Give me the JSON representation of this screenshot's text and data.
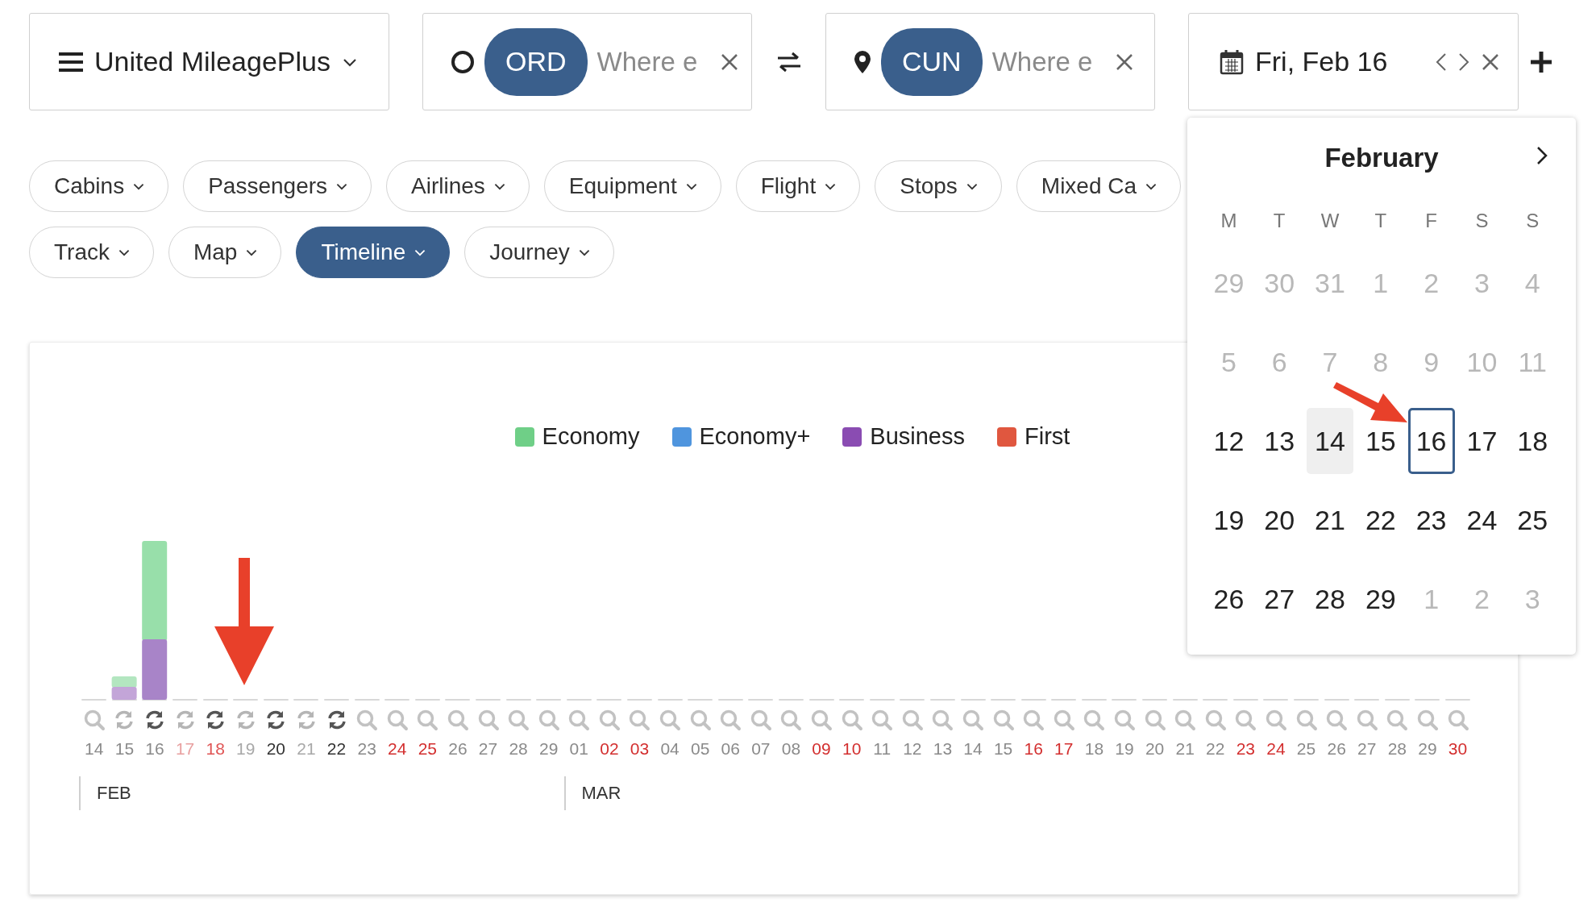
{
  "program": {
    "label": "United MileagePlus"
  },
  "origin": {
    "code": "ORD",
    "placeholder": "Where e"
  },
  "destination": {
    "code": "CUN",
    "placeholder": "Where e"
  },
  "date": {
    "label": "Fri, Feb 16"
  },
  "filters": [
    {
      "label": "Cabins",
      "selected": false
    },
    {
      "label": "Passengers",
      "selected": false
    },
    {
      "label": "Airlines",
      "selected": false
    },
    {
      "label": "Equipment",
      "selected": false
    },
    {
      "label": "Flight",
      "selected": false
    },
    {
      "label": "Stops",
      "selected": false
    },
    {
      "label": "Mixed Ca",
      "selected": false
    }
  ],
  "views": [
    {
      "label": "Track",
      "selected": false
    },
    {
      "label": "Map",
      "selected": false
    },
    {
      "label": "Timeline",
      "selected": true
    },
    {
      "label": "Journey",
      "selected": false
    }
  ],
  "legend": [
    {
      "label": "Economy",
      "color": "#6fcf87"
    },
    {
      "label": "Economy+",
      "color": "#4f95de"
    },
    {
      "label": "Business",
      "color": "#8a4cb2"
    },
    {
      "label": "First",
      "color": "#e0573f"
    }
  ],
  "months": [
    {
      "label": "FEB",
      "days": [
        {
          "label": "14",
          "kind": "search",
          "color": "#8a8a8a"
        },
        {
          "label": "15",
          "kind": "refresh-light",
          "color": "#8a8a8a"
        },
        {
          "label": "16",
          "kind": "refresh-dark",
          "color": "#8a8a8a"
        },
        {
          "label": "17",
          "kind": "refresh-light",
          "color": "#e8a0a0"
        },
        {
          "label": "18",
          "kind": "refresh-dark",
          "color": "#e05555"
        },
        {
          "label": "19",
          "kind": "refresh-light",
          "color": "#a8a8a8"
        },
        {
          "label": "20",
          "kind": "refresh-dark",
          "color": "#333333"
        },
        {
          "label": "21",
          "kind": "refresh-light",
          "color": "#a8a8a8"
        },
        {
          "label": "22",
          "kind": "refresh-dark",
          "color": "#333333"
        },
        {
          "label": "23",
          "kind": "search",
          "color": "#8a8a8a"
        },
        {
          "label": "24",
          "kind": "search",
          "color": "#d32f2f"
        },
        {
          "label": "25",
          "kind": "search",
          "color": "#d32f2f"
        },
        {
          "label": "26",
          "kind": "search",
          "color": "#8a8a8a"
        },
        {
          "label": "27",
          "kind": "search",
          "color": "#8a8a8a"
        },
        {
          "label": "28",
          "kind": "search",
          "color": "#8a8a8a"
        },
        {
          "label": "29",
          "kind": "search",
          "color": "#8a8a8a"
        }
      ]
    },
    {
      "label": "MAR",
      "days": [
        {
          "label": "01",
          "kind": "search",
          "color": "#8a8a8a"
        },
        {
          "label": "02",
          "kind": "search",
          "color": "#d32f2f"
        },
        {
          "label": "03",
          "kind": "search",
          "color": "#d32f2f"
        },
        {
          "label": "04",
          "kind": "search",
          "color": "#8a8a8a"
        },
        {
          "label": "05",
          "kind": "search",
          "color": "#8a8a8a"
        },
        {
          "label": "06",
          "kind": "search",
          "color": "#8a8a8a"
        },
        {
          "label": "07",
          "kind": "search",
          "color": "#8a8a8a"
        },
        {
          "label": "08",
          "kind": "search",
          "color": "#8a8a8a"
        },
        {
          "label": "09",
          "kind": "search",
          "color": "#d32f2f"
        },
        {
          "label": "10",
          "kind": "search",
          "color": "#d32f2f"
        },
        {
          "label": "11",
          "kind": "search",
          "color": "#8a8a8a"
        },
        {
          "label": "12",
          "kind": "search",
          "color": "#8a8a8a"
        },
        {
          "label": "13",
          "kind": "search",
          "color": "#8a8a8a"
        },
        {
          "label": "14",
          "kind": "search",
          "color": "#8a8a8a"
        },
        {
          "label": "15",
          "kind": "search",
          "color": "#8a8a8a"
        },
        {
          "label": "16",
          "kind": "search",
          "color": "#d32f2f"
        },
        {
          "label": "17",
          "kind": "search",
          "color": "#d32f2f"
        },
        {
          "label": "18",
          "kind": "search",
          "color": "#8a8a8a"
        },
        {
          "label": "19",
          "kind": "search",
          "color": "#8a8a8a"
        },
        {
          "label": "20",
          "kind": "search",
          "color": "#8a8a8a"
        },
        {
          "label": "21",
          "kind": "search",
          "color": "#8a8a8a"
        },
        {
          "label": "22",
          "kind": "search",
          "color": "#8a8a8a"
        },
        {
          "label": "23",
          "kind": "search",
          "color": "#d32f2f"
        },
        {
          "label": "24",
          "kind": "search",
          "color": "#d32f2f"
        },
        {
          "label": "25",
          "kind": "search",
          "color": "#8a8a8a"
        },
        {
          "label": "26",
          "kind": "search",
          "color": "#8a8a8a"
        },
        {
          "label": "27",
          "kind": "search",
          "color": "#8a8a8a"
        },
        {
          "label": "28",
          "kind": "search",
          "color": "#8a8a8a"
        },
        {
          "label": "29",
          "kind": "search",
          "color": "#8a8a8a"
        },
        {
          "label": "30",
          "kind": "search",
          "color": "#d32f2f"
        }
      ]
    }
  ],
  "calendar": {
    "month": "February",
    "weekdays": [
      "M",
      "T",
      "W",
      "T",
      "F",
      "S",
      "S"
    ],
    "weeks": [
      [
        {
          "label": "29",
          "disabled": true,
          "today": false,
          "selected": false
        },
        {
          "label": "30",
          "disabled": true,
          "today": false,
          "selected": false
        },
        {
          "label": "31",
          "disabled": true,
          "today": false,
          "selected": false
        },
        {
          "label": "1",
          "disabled": true,
          "today": false,
          "selected": false
        },
        {
          "label": "2",
          "disabled": true,
          "today": false,
          "selected": false
        },
        {
          "label": "3",
          "disabled": true,
          "today": false,
          "selected": false
        },
        {
          "label": "4",
          "disabled": true,
          "today": false,
          "selected": false
        }
      ],
      [
        {
          "label": "5",
          "disabled": true,
          "today": false,
          "selected": false
        },
        {
          "label": "6",
          "disabled": true,
          "today": false,
          "selected": false
        },
        {
          "label": "7",
          "disabled": true,
          "today": false,
          "selected": false
        },
        {
          "label": "8",
          "disabled": true,
          "today": false,
          "selected": false
        },
        {
          "label": "9",
          "disabled": true,
          "today": false,
          "selected": false
        },
        {
          "label": "10",
          "disabled": true,
          "today": false,
          "selected": false
        },
        {
          "label": "11",
          "disabled": true,
          "today": false,
          "selected": false
        }
      ],
      [
        {
          "label": "12",
          "disabled": false,
          "today": false,
          "selected": false
        },
        {
          "label": "13",
          "disabled": false,
          "today": false,
          "selected": false
        },
        {
          "label": "14",
          "disabled": false,
          "today": true,
          "selected": false
        },
        {
          "label": "15",
          "disabled": false,
          "today": false,
          "selected": false
        },
        {
          "label": "16",
          "disabled": false,
          "today": false,
          "selected": true
        },
        {
          "label": "17",
          "disabled": false,
          "today": false,
          "selected": false
        },
        {
          "label": "18",
          "disabled": false,
          "today": false,
          "selected": false
        }
      ],
      [
        {
          "label": "19",
          "disabled": false,
          "today": false,
          "selected": false
        },
        {
          "label": "20",
          "disabled": false,
          "today": false,
          "selected": false
        },
        {
          "label": "21",
          "disabled": false,
          "today": false,
          "selected": false
        },
        {
          "label": "22",
          "disabled": false,
          "today": false,
          "selected": false
        },
        {
          "label": "23",
          "disabled": false,
          "today": false,
          "selected": false
        },
        {
          "label": "24",
          "disabled": false,
          "today": false,
          "selected": false
        },
        {
          "label": "25",
          "disabled": false,
          "today": false,
          "selected": false
        }
      ],
      [
        {
          "label": "26",
          "disabled": false,
          "today": false,
          "selected": false
        },
        {
          "label": "27",
          "disabled": false,
          "today": false,
          "selected": false
        },
        {
          "label": "28",
          "disabled": false,
          "today": false,
          "selected": false
        },
        {
          "label": "29",
          "disabled": false,
          "today": false,
          "selected": false
        },
        {
          "label": "1",
          "disabled": true,
          "today": false,
          "selected": false
        },
        {
          "label": "2",
          "disabled": true,
          "today": false,
          "selected": false
        },
        {
          "label": "3",
          "disabled": true,
          "today": false,
          "selected": false
        }
      ]
    ]
  }
}
